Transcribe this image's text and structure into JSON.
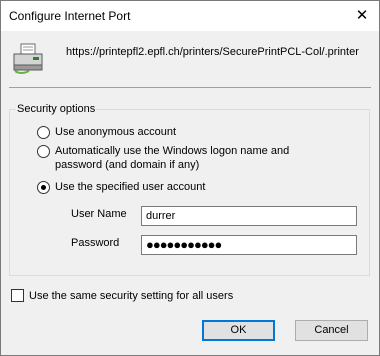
{
  "window": {
    "title": "Configure Internet Port",
    "close_glyph": "✕"
  },
  "printer": {
    "icon": "printer-icon",
    "url": "https://printepfl2.epfl.ch/printers/SecurePrintPCL-Col/.printer"
  },
  "security": {
    "group_label": "Security options",
    "options": [
      {
        "label": "Use anonymous account",
        "checked": false
      },
      {
        "label": "Automatically use the Windows logon name and password (and domain if any)",
        "checked": false
      },
      {
        "label": "Use the specified user account",
        "checked": true
      }
    ],
    "username_label": "User Name",
    "username_value": "durrer",
    "password_label": "Password",
    "password_value": "●●●●●●●●●●●"
  },
  "same_setting": {
    "label": "Use the same security setting for all users",
    "checked": false
  },
  "buttons": {
    "ok": "OK",
    "cancel": "Cancel"
  },
  "colors": {
    "accent": "#0078d7",
    "dialog_bg": "#f0f0f0"
  }
}
